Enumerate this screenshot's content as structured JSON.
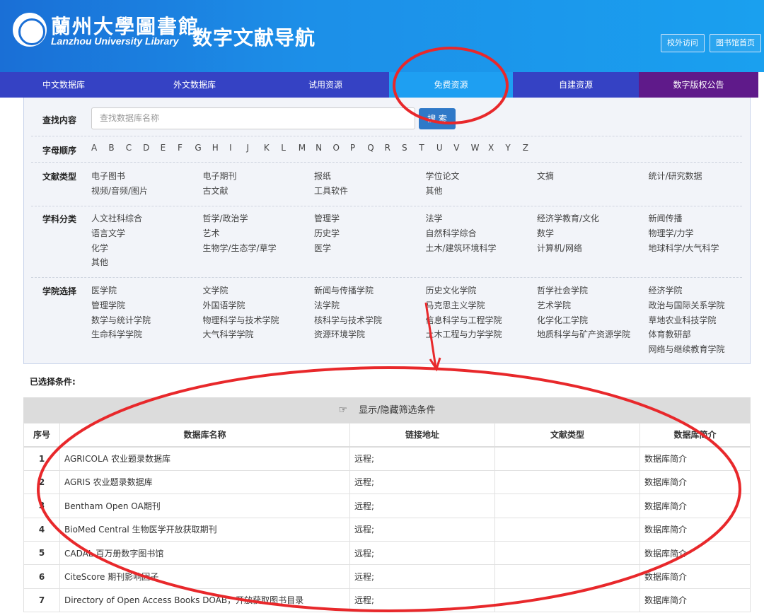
{
  "header": {
    "title_cn": "蘭州大學圖書館",
    "title_en": "Lanzhou University Library",
    "title_nav": "数字文献导航",
    "btn_remote": "校外访问",
    "btn_home": "图书馆首页"
  },
  "nav": {
    "items": [
      {
        "label": "中文数据库",
        "color": "#3542c4"
      },
      {
        "label": "外文数据库",
        "color": "#3542c4"
      },
      {
        "label": "试用资源",
        "color": "#3542c4"
      },
      {
        "label": "免费资源",
        "color": "#1e9ff2"
      },
      {
        "label": "自建资源",
        "color": "#3542c4"
      },
      {
        "label": "数字版权公告",
        "color": "#5f1a8a"
      }
    ]
  },
  "filter": {
    "search_label": "查找内容",
    "search_placeholder": "查找数据库名称",
    "search_button": "搜 索",
    "letters_label": "字母顺序",
    "letters": [
      "A",
      "B",
      "C",
      "D",
      "E",
      "F",
      "G",
      "H",
      "I",
      "J",
      "K",
      "L",
      "M",
      "N",
      "O",
      "P",
      "Q",
      "R",
      "S",
      "T",
      "U",
      "V",
      "W",
      "X",
      "Y",
      "Z"
    ],
    "doc_type_label": "文献类型",
    "doc_types": [
      "电子图书",
      "电子期刊",
      "报纸",
      "学位论文",
      "文摘",
      "统计/研究数据",
      "视频/音频/图片",
      "古文献",
      "工具软件",
      "其他"
    ],
    "subject_label": "学科分类",
    "subjects": [
      "人文社科综合",
      "哲学/政治学",
      "管理学",
      "法学",
      "经济学教育/文化",
      "新闻传播",
      "语言文学",
      "艺术",
      "历史学",
      "自然科学综合",
      "数学",
      "物理学/力学",
      "化学",
      "生物学/生态学/草学",
      "医学",
      "土木/建筑环境科学",
      "计算机/网络",
      "地球科学/大气科学",
      "其他"
    ],
    "college_label": "学院选择",
    "colleges": [
      "医学院",
      "文学院",
      "新闻与传播学院",
      "历史文化学院",
      "哲学社会学院",
      "经济学院",
      "管理学院",
      "外国语学院",
      "法学院",
      "马克思主义学院",
      "艺术学院",
      "政治与国际关系学院",
      "数学与统计学院",
      "物理科学与技术学院",
      "核科学与技术学院",
      "信息科学与工程学院",
      "化学化工学院",
      "草地农业科技学院",
      "生命科学学院",
      "大气科学学院",
      "资源环境学院",
      "土木工程与力学学院",
      "地质科学与矿产资源学院",
      "体育教研部",
      "",
      "",
      "",
      "",
      "",
      "网络与继续教育学院"
    ]
  },
  "selected_label": "已选择条件:",
  "toggle_label": "显示/隐藏筛选条件",
  "table": {
    "headers": [
      "序号",
      "数据库名称",
      "链接地址",
      "文献类型",
      "数据库简介"
    ],
    "rows": [
      {
        "num": "1",
        "name": "AGRICOLA 农业题录数据库",
        "link": "远程;",
        "type": "",
        "intro": "数据库简介"
      },
      {
        "num": "2",
        "name": "AGRIS 农业题录数据库",
        "link": "远程;",
        "type": "",
        "intro": "数据库简介"
      },
      {
        "num": "3",
        "name": "Bentham Open OA期刊",
        "link": "远程;",
        "type": "",
        "intro": "数据库简介"
      },
      {
        "num": "4",
        "name": "BioMed Central 生物医学开放获取期刊",
        "link": "远程;",
        "type": "",
        "intro": "数据库简介"
      },
      {
        "num": "5",
        "name": "CADAL 百万册数字图书馆",
        "link": "远程;",
        "type": "",
        "intro": "数据库简介"
      },
      {
        "num": "6",
        "name": "CiteScore 期刊影响因子",
        "link": "远程;",
        "type": "",
        "intro": "数据库简介"
      },
      {
        "num": "7",
        "name": "Directory of Open Access Books DOAB，开放获取图书目录",
        "link": "远程;",
        "type": "",
        "intro": "数据库简介"
      }
    ]
  },
  "annotation_color": "#e8282b"
}
